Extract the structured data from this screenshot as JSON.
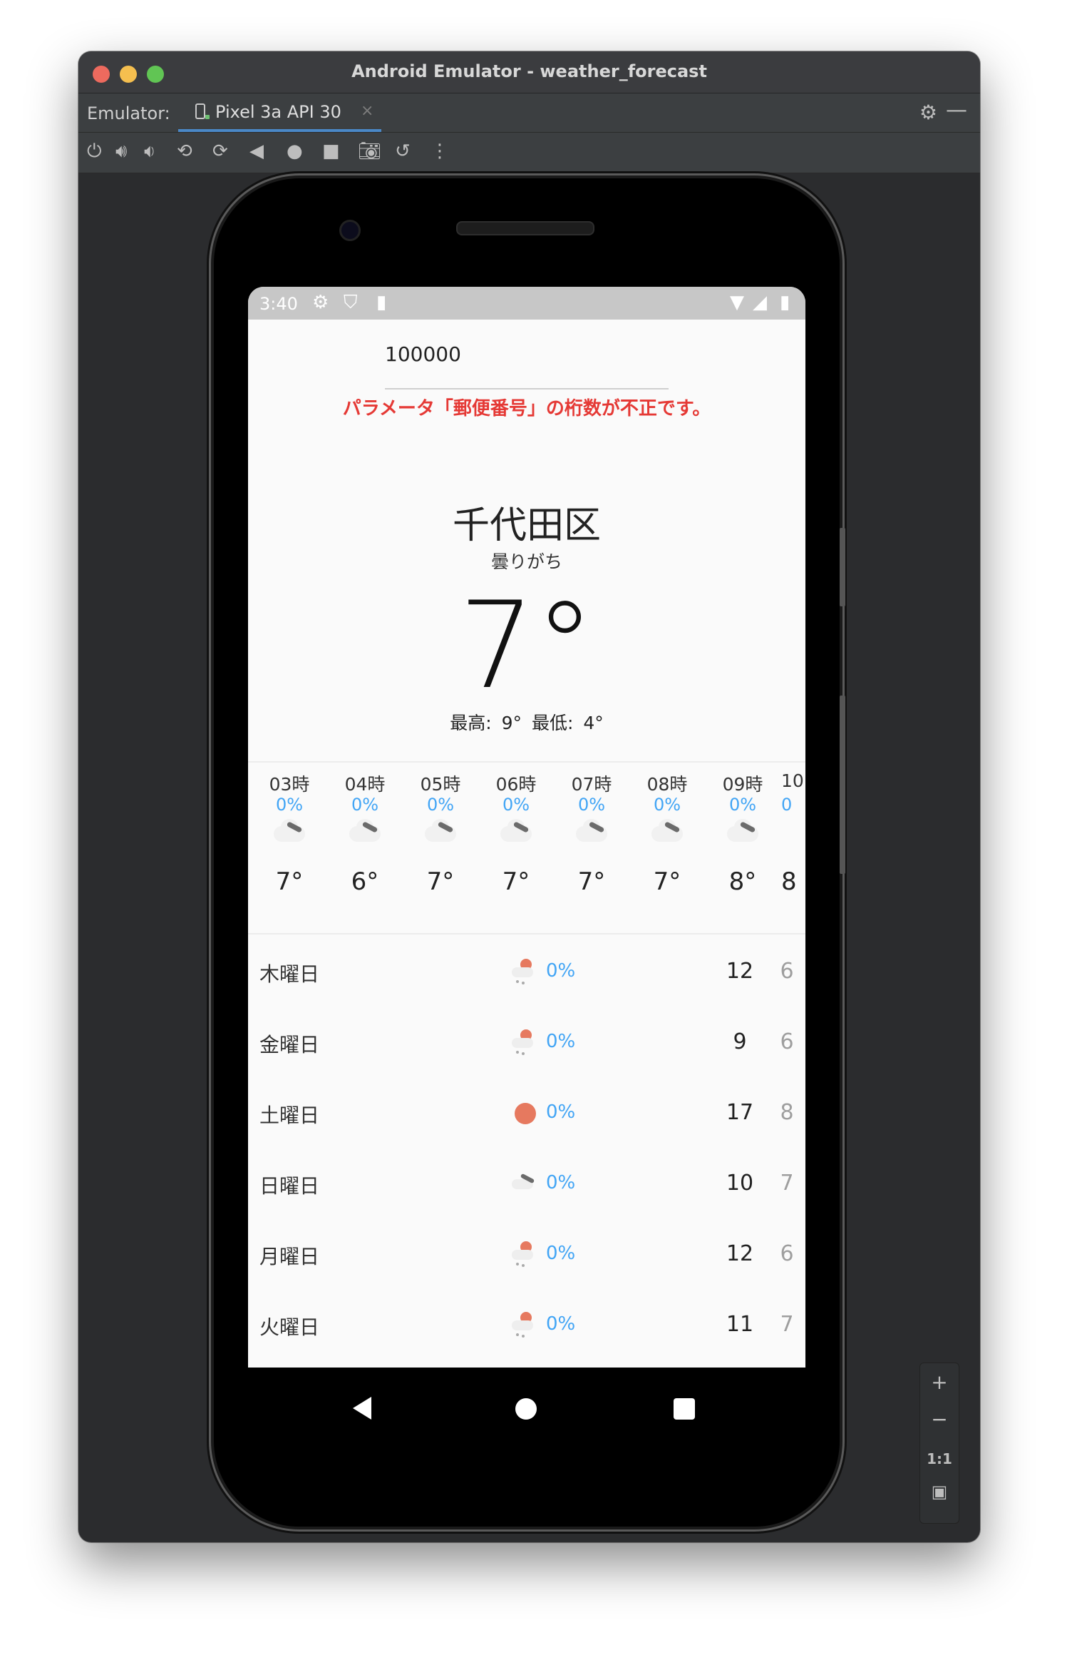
{
  "window": {
    "title": "Android Emulator - weather_forecast"
  },
  "tabbar": {
    "label": "Emulator:",
    "tab_name": "Pixel 3a API 30",
    "close_glyph": "×"
  },
  "toolbar": {
    "icons": [
      "power-icon",
      "volume-up-icon",
      "volume-down-icon",
      "rotate-left-icon",
      "rotate-right-icon",
      "back-icon",
      "home-icon",
      "overview-icon",
      "screenshot-icon",
      "snapshot-icon",
      "more-icon"
    ]
  },
  "statusbar": {
    "time": "3:40"
  },
  "app": {
    "zip_value": "100000",
    "error_message": "パラメータ「郵便番号」の桁数が不正です。",
    "city": "千代田区",
    "condition": "曇りがち",
    "current_temp": "7°",
    "hi_lo": "最高: 9°  最低: 4°"
  },
  "hourly": [
    {
      "time": "03時",
      "precip": "0%",
      "temp": "7°"
    },
    {
      "time": "04時",
      "precip": "0%",
      "temp": "6°"
    },
    {
      "time": "05時",
      "precip": "0%",
      "temp": "7°"
    },
    {
      "time": "06時",
      "precip": "0%",
      "temp": "7°"
    },
    {
      "time": "07時",
      "precip": "0%",
      "temp": "7°"
    },
    {
      "time": "08時",
      "precip": "0%",
      "temp": "7°"
    },
    {
      "time": "09時",
      "precip": "0%",
      "temp": "8°"
    },
    {
      "time": "10",
      "precip": "0",
      "temp": "8"
    }
  ],
  "daily": [
    {
      "day": "木曜日",
      "icon": "partly-sunny-rain-icon",
      "precip": "0%",
      "high": "12",
      "low": "6"
    },
    {
      "day": "金曜日",
      "icon": "partly-sunny-rain-icon",
      "precip": "0%",
      "high": "9",
      "low": "6"
    },
    {
      "day": "土曜日",
      "icon": "sun-icon",
      "precip": "0%",
      "high": "17",
      "low": "8"
    },
    {
      "day": "日曜日",
      "icon": "cloud-icon",
      "precip": "0%",
      "high": "10",
      "low": "7"
    },
    {
      "day": "月曜日",
      "icon": "partly-sunny-rain-icon",
      "precip": "0%",
      "high": "12",
      "low": "6"
    },
    {
      "day": "火曜日",
      "icon": "partly-sunny-rain-icon",
      "precip": "0%",
      "high": "11",
      "low": "7"
    }
  ],
  "zoom": {
    "plus": "+",
    "minus": "−",
    "one_to_one": "1:1"
  },
  "colors": {
    "error": "#e53935",
    "precip": "#42a5f5",
    "sun": "#e6795f",
    "tab_accent": "#4a88c7"
  }
}
